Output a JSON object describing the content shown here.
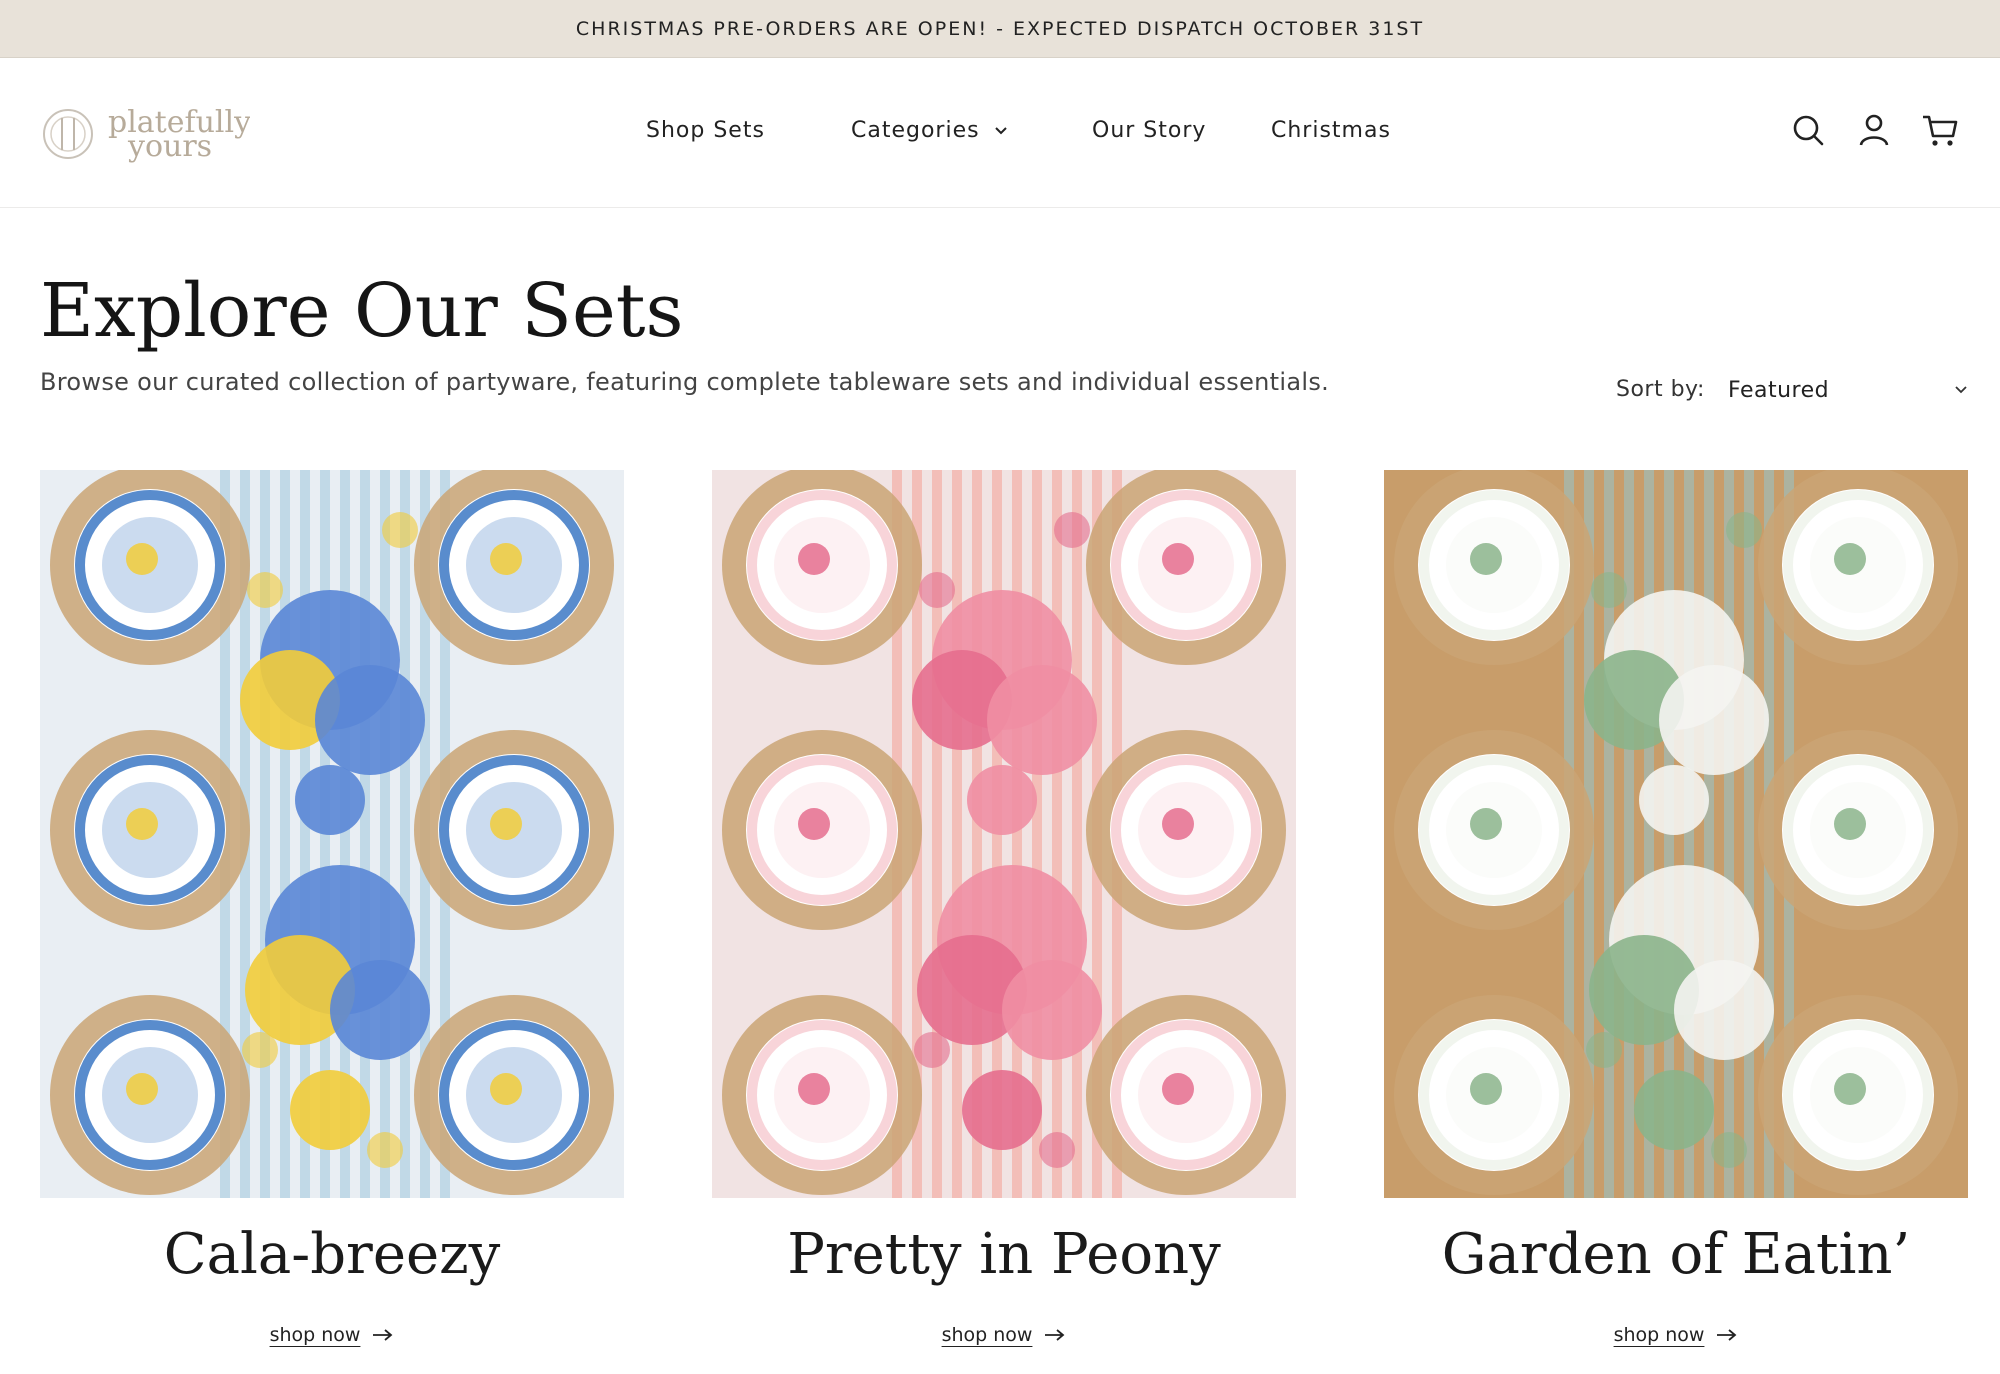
{
  "announcement": {
    "text": "CHRISTMAS PRE-ORDERS ARE OPEN! - EXPECTED DISPATCH OCTOBER 31ST"
  },
  "header": {
    "logo_text": [
      "platefully",
      "yours"
    ],
    "nav": [
      {
        "label": "Shop Sets"
      },
      {
        "label": "Categories",
        "has_dropdown": true
      },
      {
        "label": "Our Story"
      },
      {
        "label": "Christmas"
      }
    ],
    "icons": [
      "search-icon",
      "account-icon",
      "cart-icon"
    ]
  },
  "main": {
    "title": "Explore Our Sets",
    "subtitle": "Browse our curated collection of partyware, featuring complete tableware sets and individual essentials.",
    "sort": {
      "label": "Sort by:",
      "selected": "Featured"
    }
  },
  "products": [
    {
      "title": "Cala-breezy",
      "link": "shop now",
      "palette": {
        "bg": "#e9eef3",
        "runner": "#bcd6e6",
        "plate": "#2f6fc0",
        "accent": "#f2cc3a",
        "flower": "#5a86d6"
      }
    },
    {
      "title": "Pretty in Peony",
      "link": "shop now",
      "palette": {
        "bg": "#f1e3e3",
        "runner": "#f3b9b2",
        "plate": "#f6c9cf",
        "accent": "#e56e8e",
        "flower": "#ef8ea3"
      }
    },
    {
      "title": "Garden of Eatin’",
      "link": "shop now",
      "palette": {
        "bg": "#c89d6a",
        "runner": "#a9b6a6",
        "plate": "#eef2ea",
        "accent": "#8bb48b",
        "flower": "#f4f4f1"
      }
    }
  ]
}
